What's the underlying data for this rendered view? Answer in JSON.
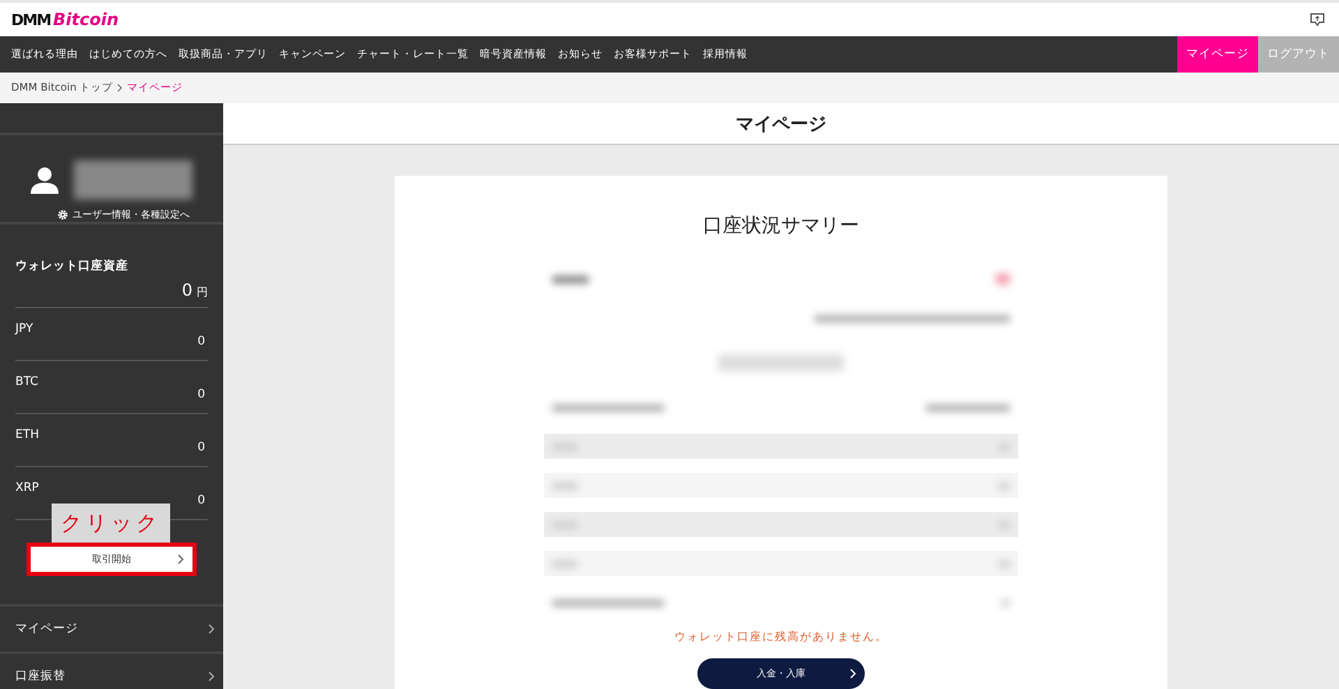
{
  "header": {
    "logo_prefix": "DMM",
    "logo_brand": "Bitcoin"
  },
  "nav": {
    "items": [
      "選ばれる理由",
      "はじめての方へ",
      "取扱商品・アプリ",
      "キャンペーン",
      "チャート・レート一覧",
      "暗号資産情報",
      "お知らせ",
      "お客様サポート",
      "採用情報"
    ],
    "actions": [
      {
        "label": "マイページ",
        "kind": "primary"
      },
      {
        "label": "ログアウト",
        "kind": "secondary"
      }
    ]
  },
  "breadcrumb": [
    {
      "label": "DMM Bitcoin トップ",
      "selected": false
    },
    {
      "label": "マイページ",
      "selected": true
    }
  ],
  "sidebar": {
    "user_link": "ユーザー情報・各種設定へ",
    "wallet_title": "ウォレット口座資産",
    "wallet_total": "0",
    "wallet_unit": "円",
    "assets": [
      {
        "name": "JPY",
        "amount": "0"
      },
      {
        "name": "BTC",
        "amount": "0"
      },
      {
        "name": "ETH",
        "amount": "0"
      },
      {
        "name": "XRP",
        "amount": "0"
      }
    ],
    "trade_button": "取引開始",
    "annotation": "クリック",
    "menu": [
      "マイページ",
      "口座振替"
    ]
  },
  "page_title": "マイページ",
  "summary": {
    "title": "口座状況サマリー",
    "notice": "ウォレット口座に残高がありません。",
    "button": "入金・入庫"
  }
}
